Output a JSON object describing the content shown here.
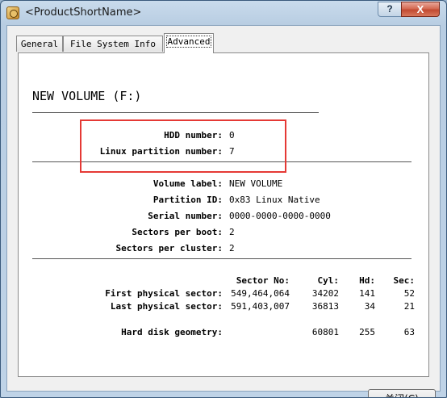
{
  "window": {
    "title": "<ProductShortName>",
    "help_glyph": "?",
    "close_glyph": "X"
  },
  "tabs": [
    {
      "label": "General",
      "active": false
    },
    {
      "label": "File System Info",
      "active": false
    },
    {
      "label": "Advanced",
      "active": true
    }
  ],
  "volume": {
    "heading": "NEW VOLUME  (F:)"
  },
  "highlighted": {
    "hdd_number_label": "HDD number:",
    "hdd_number_value": "0",
    "partition_number_label": "Linux partition number:",
    "partition_number_value": "7"
  },
  "details": {
    "volume_label_label": "Volume label:",
    "volume_label_value": "NEW VOLUME",
    "partition_id_label": "Partition ID:",
    "partition_id_value": "0x83 Linux Native",
    "serial_label": "Serial number:",
    "serial_value": "0000-0000-0000-0000",
    "sectors_boot_label": "Sectors per boot:",
    "sectors_boot_value": "2",
    "sectors_cluster_label": "Sectors per cluster:",
    "sectors_cluster_value": "2"
  },
  "geometry": {
    "headers": {
      "sector": "Sector No:",
      "cyl": "Cyl:",
      "hd": "Hd:",
      "sec": "Sec:"
    },
    "first": {
      "label": "First physical sector:",
      "sector": "549,464,064",
      "cyl": "34202",
      "hd": "141",
      "sec": "52"
    },
    "last": {
      "label": "Last physical sector:",
      "sector": "591,403,007",
      "cyl": "36813",
      "hd": "34",
      "sec": "21"
    },
    "disk": {
      "label": "Hard disk geometry:",
      "cyl": "60801",
      "hd": "255",
      "sec": "63"
    }
  },
  "footer": {
    "close_label": "关闭(C)"
  },
  "highlight_color": "#e53935"
}
